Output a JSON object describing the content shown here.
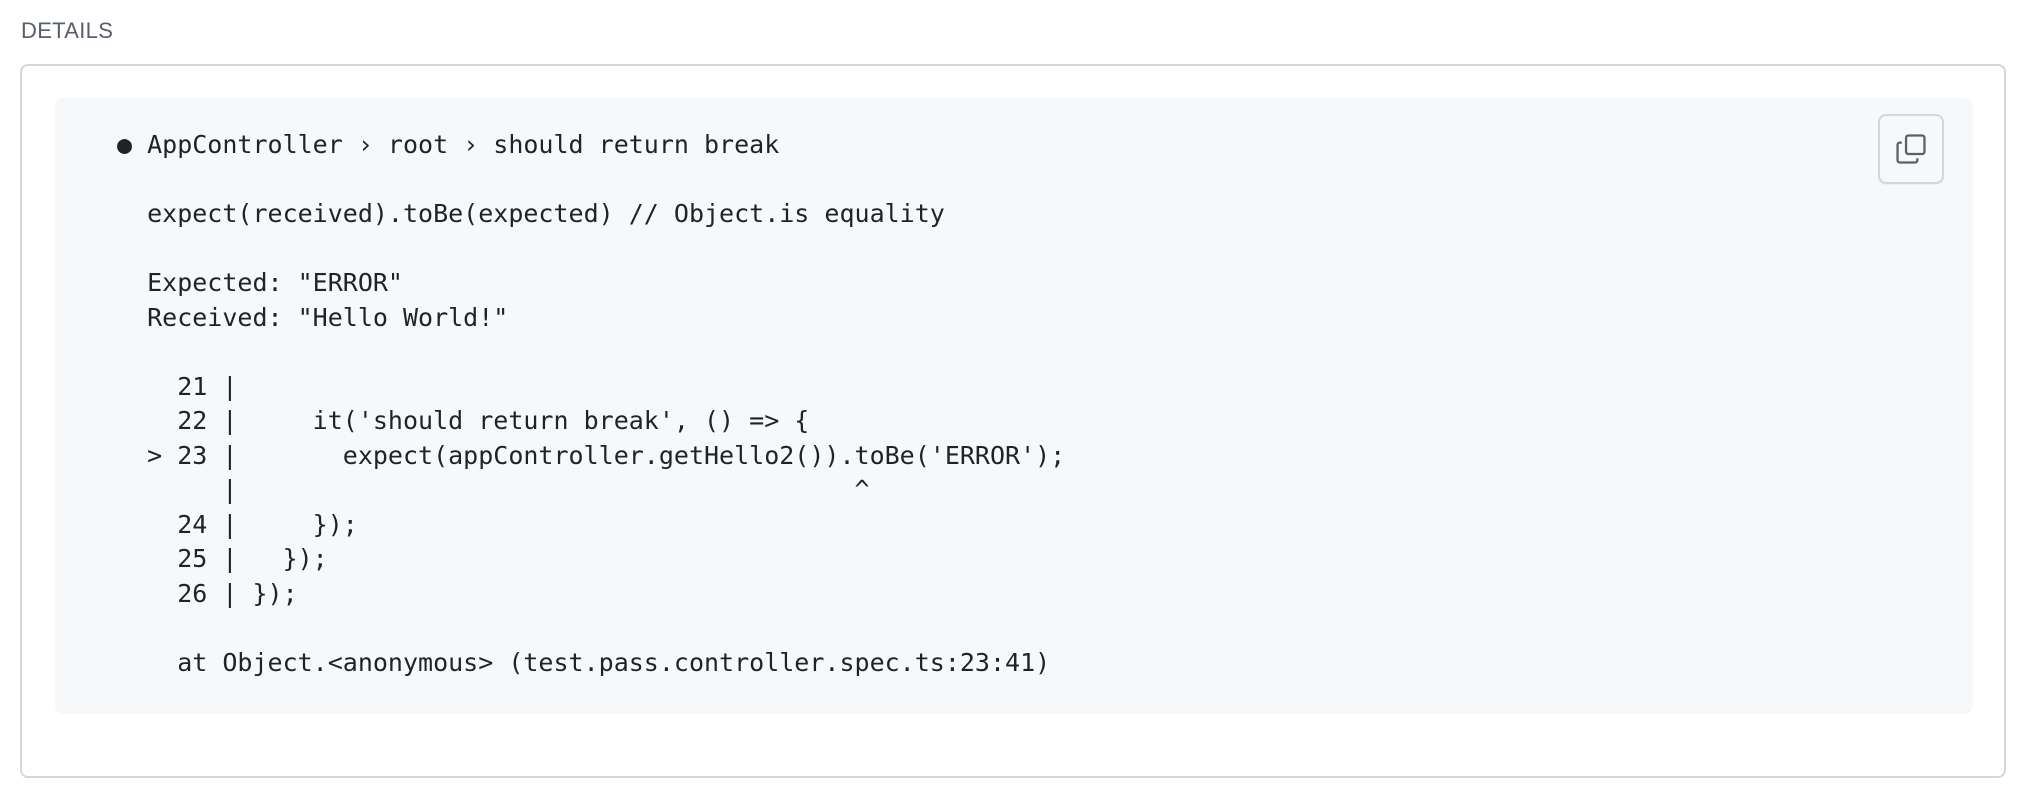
{
  "section": {
    "title": "DETAILS"
  },
  "code_block": {
    "lines": [
      "● AppController › root › should return break",
      "",
      "  expect(received).toBe(expected) // Object.is equality",
      "",
      "  Expected: \"ERROR\"",
      "  Received: \"Hello World!\"",
      "",
      "    21 |",
      "    22 |     it('should return break', () => {",
      "  > 23 |       expect(appController.getHello2()).toBe('ERROR');",
      "       |                                         ^",
      "    24 |     });",
      "    25 |   });",
      "    26 | });",
      "",
      "    at Object.<anonymous> (test.pass.controller.spec.ts:23:41)"
    ]
  },
  "copy_button": {
    "icon": "copy-icon"
  },
  "colors": {
    "code_background": "#f6f8fa",
    "border": "#d0d7de",
    "text": "#1f2328",
    "header_text": "#57606a"
  }
}
